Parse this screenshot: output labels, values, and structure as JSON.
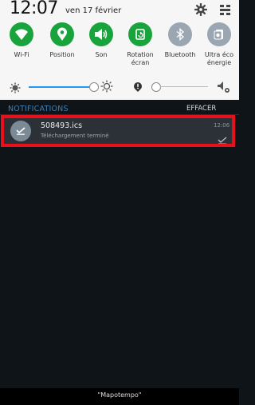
{
  "status": {
    "time": "12:07",
    "date": "ven 17 février"
  },
  "toggles": [
    {
      "label_line1": "Wi-Fi",
      "label_line2": "",
      "icon": "wifi-icon",
      "state": "on"
    },
    {
      "label_line1": "Position",
      "label_line2": "",
      "icon": "location-icon",
      "state": "on"
    },
    {
      "label_line1": "Son",
      "label_line2": "",
      "icon": "sound-icon",
      "state": "on"
    },
    {
      "label_line1": "Rotation",
      "label_line2": "écran",
      "icon": "rotation-icon",
      "state": "on"
    },
    {
      "label_line1": "Bluetooth",
      "label_line2": "",
      "icon": "bluetooth-icon",
      "state": "off"
    },
    {
      "label_line1": "Ultra éco",
      "label_line2": "énergie",
      "icon": "power-saving-icon",
      "state": "off"
    }
  ],
  "brightness": {
    "level": 0.82
  },
  "notifications": {
    "title": "NOTIFICATIONS",
    "clear_label": "EFFACER",
    "items": [
      {
        "title": "508493.ics",
        "subtitle": "Téléchargement terminé",
        "time": "12:06",
        "icon": "download-done-icon"
      }
    ]
  },
  "bottom": {
    "label": "\"Mapotempo\""
  },
  "colors": {
    "toggle_on": "#19a33d",
    "toggle_off": "#9aa6b2",
    "accent": "#2196f3",
    "highlight": "#e8101a"
  }
}
